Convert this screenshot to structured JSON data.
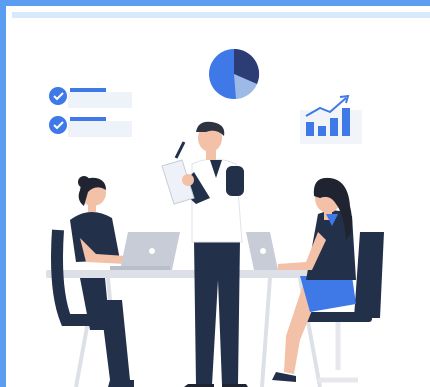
{
  "illustration": {
    "name": "team-meeting-illustration",
    "icons": [
      "checklist-icon",
      "pie-chart-icon",
      "bar-chart-growth-icon",
      "laptop-icon"
    ]
  },
  "colors": {
    "frame_border": "#5b9df0",
    "navy": "#233049",
    "accent_blue": "#3f79e8",
    "skin": "#f3c0a8"
  }
}
